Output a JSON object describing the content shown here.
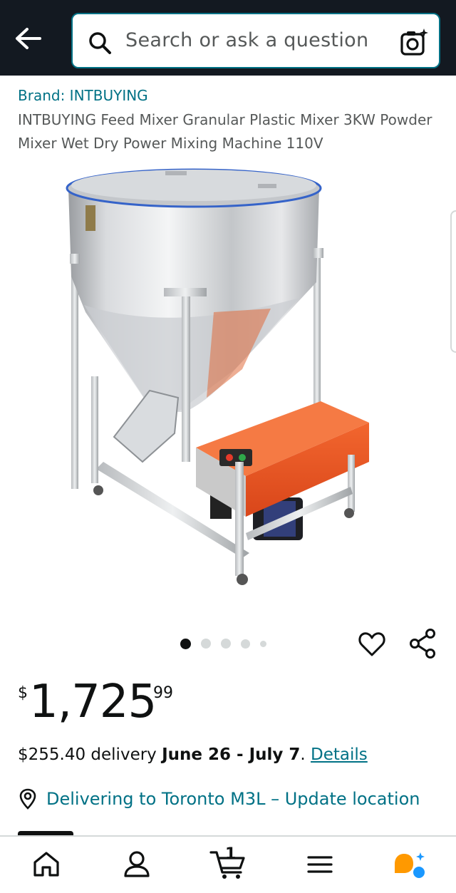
{
  "header": {
    "back_icon": "back-arrow-icon",
    "search_placeholder": "Search or ask a question",
    "search_icon": "search-icon",
    "camera_icon": "camera-lens-icon"
  },
  "product": {
    "brand": "Brand: INTBUYING",
    "title": "INTBUYING Feed Mixer Granular Plastic Mixer 3KW Powder Mixer Wet Dry Power Mixing Machine 110V",
    "image_count": 5,
    "active_image": 0
  },
  "price": {
    "symbol": "$",
    "whole": "1,725",
    "fraction": "99"
  },
  "delivery": {
    "cost": "$255.40 delivery ",
    "dates": "June 26 - July 7",
    "period": ". ",
    "details_link": "Details"
  },
  "location": {
    "text": "Delivering to Toronto M3L – Update location"
  },
  "bottom_nav": {
    "cart_count": "1",
    "items": [
      "home-icon",
      "account-icon",
      "cart-icon",
      "menu-icon",
      "rufus-assistant-icon"
    ]
  },
  "colors": {
    "header_bg": "#131921",
    "link": "#007185",
    "text": "#0f1111",
    "secondary_text": "#565959",
    "accent_orange": "#ff9900",
    "assistant_blue": "#1a98ff"
  }
}
